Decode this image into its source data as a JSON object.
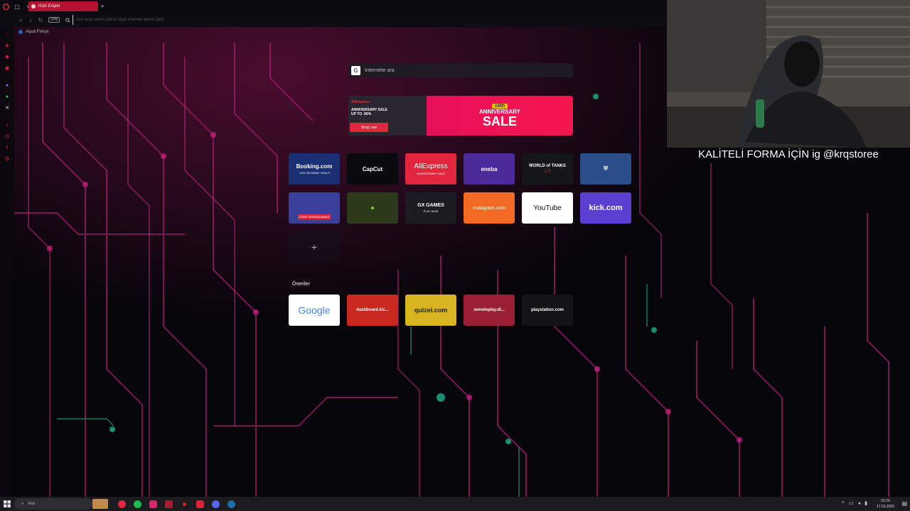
{
  "browser": {
    "active_tab_title": "Hızlı Erişim",
    "new_tab_icon": "+",
    "address_placeholder": "Ara veya adres yazın veya internet adresi girin",
    "vpn_label": "VPN",
    "bookmark_label": "Aqua Florya"
  },
  "search": {
    "placeholder": "İnternette ara",
    "engine_icon": "G"
  },
  "promo": {
    "brand": "AliExpress",
    "line1": "ANNIVERSARY SALE",
    "line2": "UP TO -90%",
    "shop_button": "Shop now",
    "badge": "16th",
    "anniversary": "ANNIVERSARY",
    "sale": "SALE"
  },
  "speed_dials": [
    {
      "label": "Booking.com",
      "sub": "-15% GETAWAY DEALS",
      "color": "#1a2f72"
    },
    {
      "label": "CapCut",
      "sub": "",
      "color": "#0a0a0d"
    },
    {
      "label": "AliExpress",
      "sub": "ANNIVERSARY SALE",
      "color": "#e0273e"
    },
    {
      "label": "eneba",
      "sub": "",
      "color": "#4b2a9a"
    },
    {
      "label": "WORLD of TANKS",
      "sub": "2.0",
      "color": "#141618"
    },
    {
      "label": "",
      "sub": "",
      "color": "#2a4e8a"
    },
    {
      "label": "",
      "sub": "CODE OPERAGAMING",
      "color": "#3a3f9a"
    },
    {
      "label": "",
      "sub": "",
      "color": "#2c3a1c"
    },
    {
      "label": "GX GAMES",
      "sub": "PLAY NOW",
      "color": "#1d1b22"
    },
    {
      "label": "instagram.com",
      "sub": "",
      "color": "#f06a22"
    },
    {
      "label": "YouTube",
      "sub": "",
      "color": "#ffffff"
    },
    {
      "label": "kick.com",
      "sub": "",
      "color": "#5a3fd0"
    }
  ],
  "suggestions_title": "Öneriler",
  "suggestions": [
    {
      "label": "Google",
      "color": "#ffffff"
    },
    {
      "label": "dashboard.kic...",
      "color": "#c8281e"
    },
    {
      "label": "quizei.com",
      "color": "#d8b420"
    },
    {
      "label": "remoteplay.dl...",
      "color": "#9a1e34"
    },
    {
      "label": "playstation.com",
      "color": "#141416"
    }
  ],
  "overlay_caption": "KALİTELİ FORMA İÇİN ig @krqstoree",
  "taskbar": {
    "search_placeholder": "Ara",
    "time": "02:29",
    "date": "17.03.2025"
  }
}
